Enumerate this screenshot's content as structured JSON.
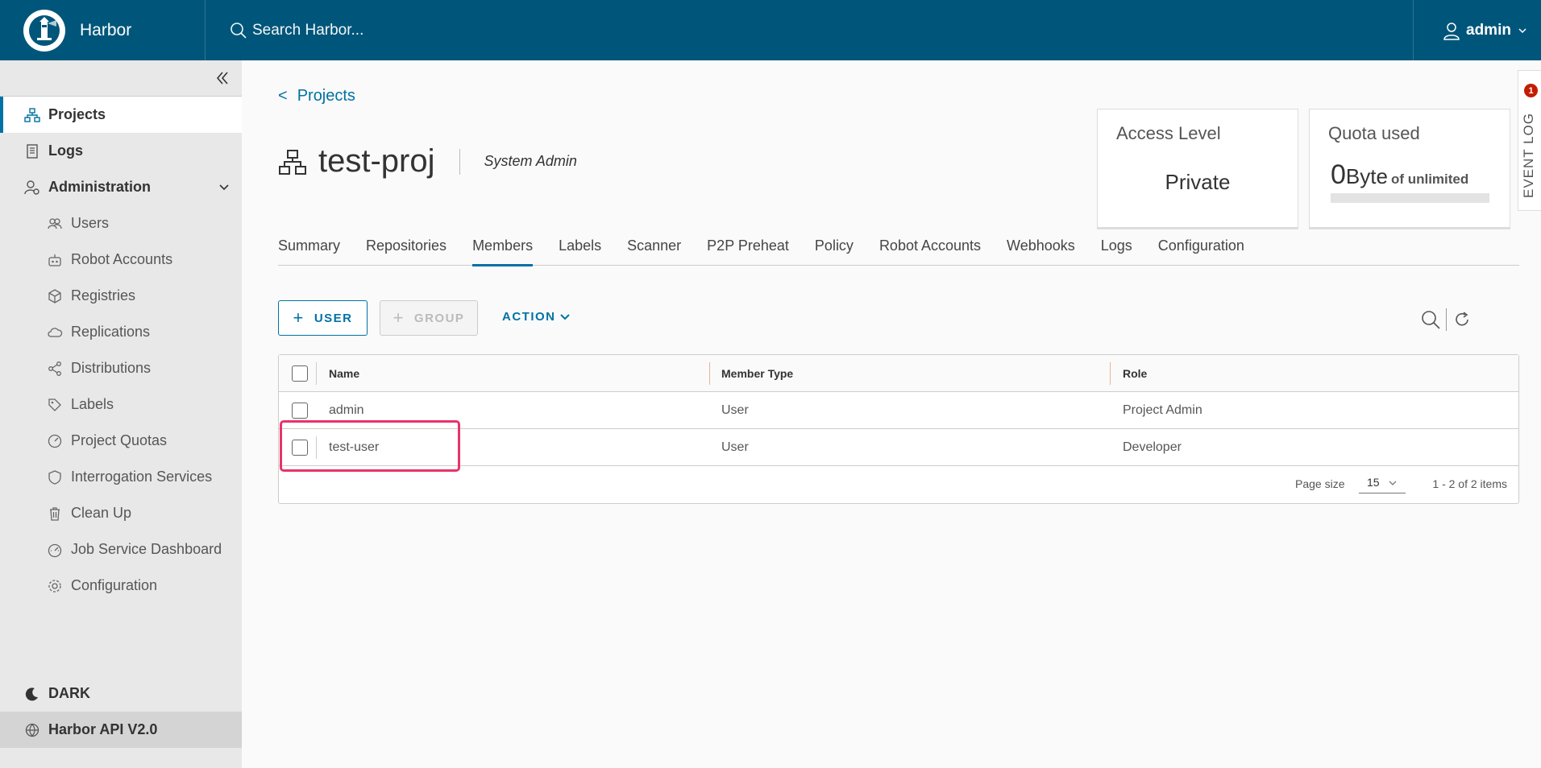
{
  "header": {
    "brand": "Harbor",
    "search_placeholder": "Search Harbor...",
    "username": "admin"
  },
  "sidebar": {
    "items": [
      {
        "label": "Projects",
        "icon": "projects-icon",
        "active": true
      },
      {
        "label": "Logs",
        "icon": "logs-icon"
      },
      {
        "label": "Administration",
        "icon": "administration-icon"
      }
    ],
    "admin_items": [
      {
        "label": "Users",
        "icon": "users-icon"
      },
      {
        "label": "Robot Accounts",
        "icon": "robot-icon"
      },
      {
        "label": "Registries",
        "icon": "registries-icon"
      },
      {
        "label": "Replications",
        "icon": "replications-icon"
      },
      {
        "label": "Distributions",
        "icon": "distributions-icon"
      },
      {
        "label": "Labels",
        "icon": "labels-icon"
      },
      {
        "label": "Project Quotas",
        "icon": "quotas-icon"
      },
      {
        "label": "Interrogation Services",
        "icon": "shield-icon"
      },
      {
        "label": "Clean Up",
        "icon": "trash-icon"
      },
      {
        "label": "Job Service Dashboard",
        "icon": "dashboard-icon"
      },
      {
        "label": "Configuration",
        "icon": "gear-icon"
      }
    ],
    "dark_label": "DARK",
    "api_label": "Harbor API V2.0"
  },
  "breadcrumb": {
    "label": "Projects",
    "arrow": "<"
  },
  "project": {
    "name": "test-proj",
    "role": "System Admin"
  },
  "access_level": {
    "title": "Access Level",
    "value": "Private"
  },
  "quota": {
    "title": "Quota used",
    "number": "0",
    "unit": "Byte",
    "of": "of unlimited",
    "fraction": 0
  },
  "event_log": {
    "label": "EVENT LOG",
    "count": "1"
  },
  "tabs": [
    "Summary",
    "Repositories",
    "Members",
    "Labels",
    "Scanner",
    "P2P Preheat",
    "Policy",
    "Robot Accounts",
    "Webhooks",
    "Logs",
    "Configuration"
  ],
  "active_tab": "Members",
  "toolbar": {
    "user_button": "USER",
    "group_button": "GROUP",
    "action_button": "ACTION"
  },
  "table": {
    "columns": [
      "Name",
      "Member Type",
      "Role"
    ],
    "rows": [
      {
        "name": "admin",
        "type": "User",
        "role": "Project Admin"
      },
      {
        "name": "test-user",
        "type": "User",
        "role": "Developer"
      }
    ],
    "page_size_label": "Page size",
    "page_size": "15",
    "pagination": "1 - 2 of 2 items"
  },
  "colors": {
    "header": "#00567a",
    "accent": "#0072a3",
    "highlight": "#e8336a",
    "badge": "#c21d00"
  }
}
